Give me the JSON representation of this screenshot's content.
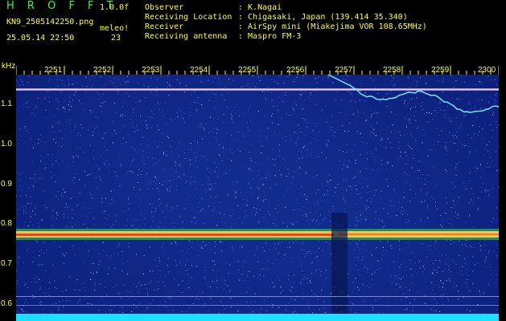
{
  "app": {
    "title": "H R O F F T",
    "version": "1.0.0f"
  },
  "file": {
    "name": "KN9_2505142250.png",
    "algorithm": "meleo!",
    "timestamp": "25.05.14 22:50",
    "count": "23"
  },
  "info": [
    {
      "label": "Observer",
      "value": ": K.Nagai"
    },
    {
      "label": "Receiving Location",
      "value": ": Chigasaki, Japan (139.414 35.340)"
    },
    {
      "label": "Receiver",
      "value": ": AirSpy mini (Miakejima VOR 108.65MHz)"
    },
    {
      "label": "Receiving antenna",
      "value": ": Maspro FM-3"
    }
  ],
  "axis": {
    "y_unit": "kHz",
    "y_ticks": [
      "1.1",
      "1.0",
      "0.9",
      "0.8",
      "0.7",
      "0.6"
    ],
    "x_ticks": [
      "2251",
      "2252",
      "2253",
      "2254",
      "2255",
      "2256",
      "2257",
      "2258",
      "2259",
      "2300"
    ]
  },
  "colors": {
    "background": "#0b1f7a",
    "band": "#ff3b2f",
    "text": "#ffff33",
    "title": "#2fff2f",
    "trace": "#7fe0ff"
  }
}
